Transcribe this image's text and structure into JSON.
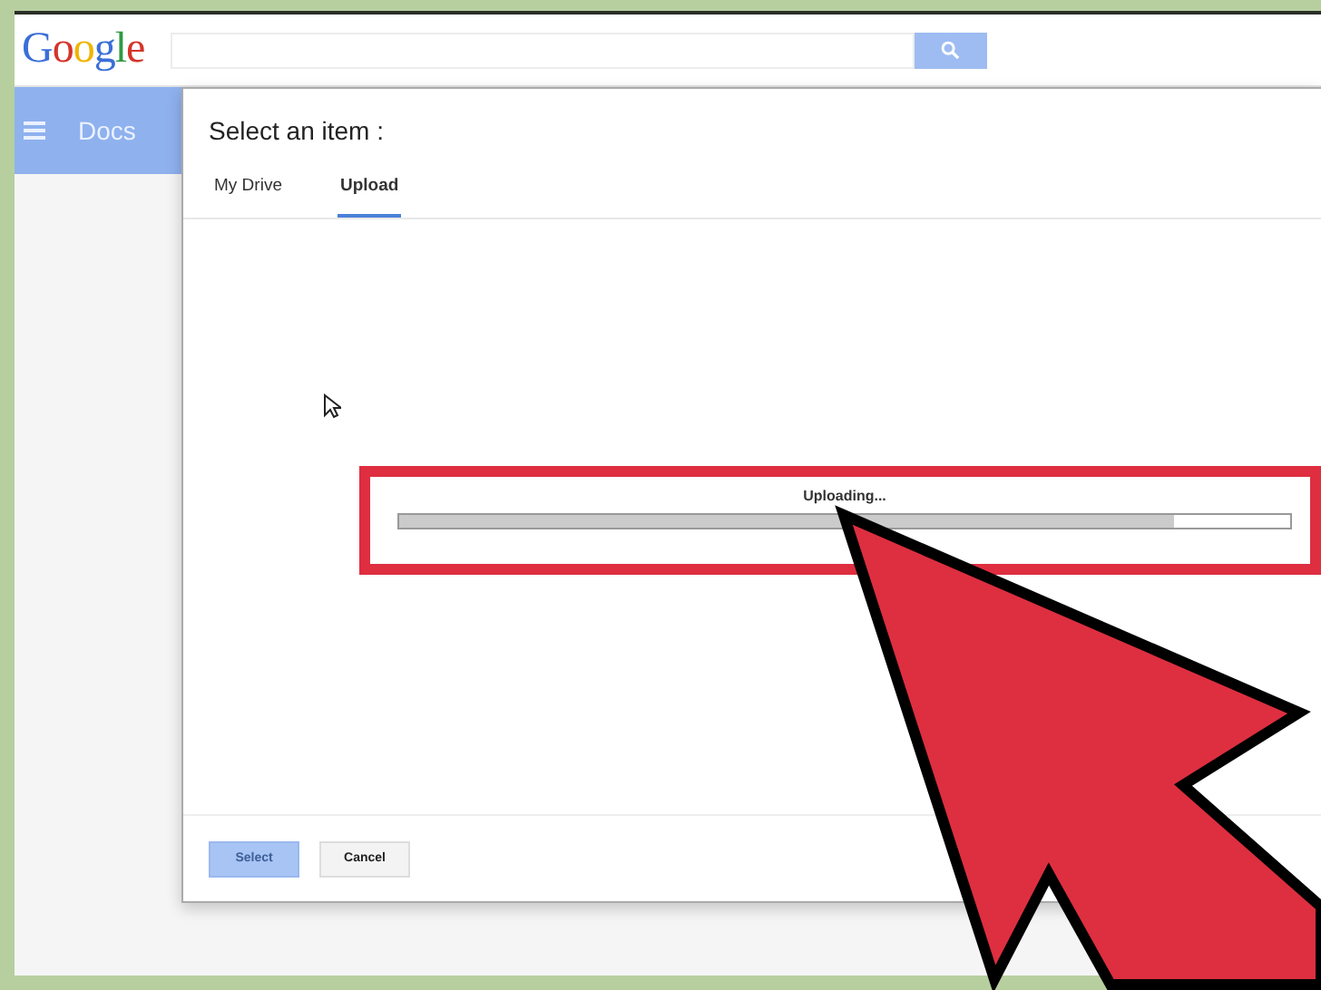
{
  "header": {
    "logo": "Google",
    "search": {
      "kind": "field"
    }
  },
  "sidebar": {
    "title": "Docs"
  },
  "dialog": {
    "title": "Select an item :",
    "tabs": [
      {
        "label": "My Drive",
        "selected": false
      },
      {
        "label": "Upload",
        "selected": true
      }
    ],
    "upload": {
      "status": "Uploading...",
      "level": 0.87,
      "highlighted": true
    },
    "buttons": [
      {
        "label": "Select",
        "kind": "primary",
        "disabled": true
      },
      {
        "label": "Cancel",
        "kind": "secondary",
        "disabled": false
      }
    ]
  }
}
